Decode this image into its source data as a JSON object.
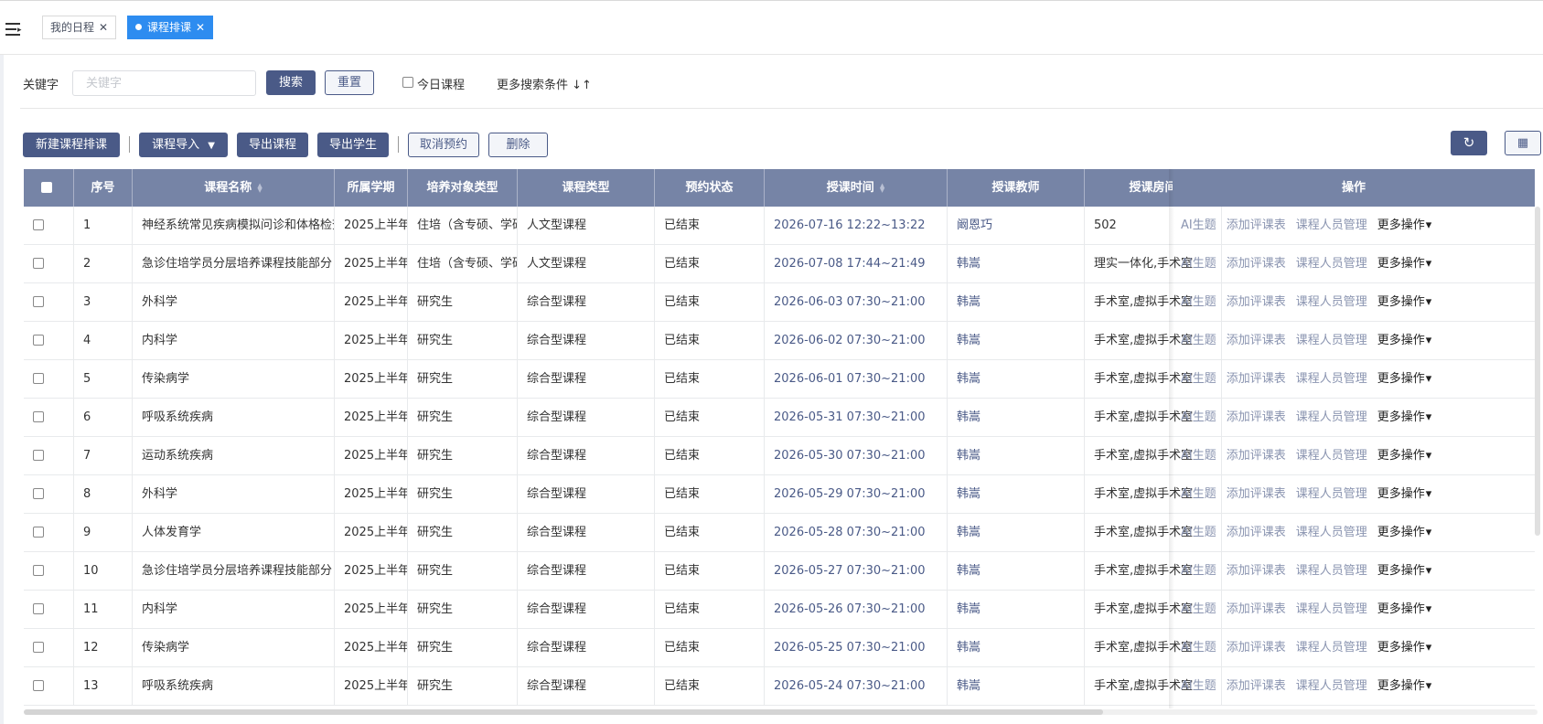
{
  "tabs": [
    {
      "label": "我的日程",
      "active": false
    },
    {
      "label": "课程排课",
      "active": true
    }
  ],
  "search": {
    "keyword_label": "关键字",
    "keyword_placeholder": "关键字",
    "keyword_value": "",
    "search_btn": "搜索",
    "reset_btn": "重置",
    "today_label": "今日课程",
    "today_checked": false,
    "more_conditions": "更多搜索条件 ↓↑"
  },
  "toolbar": {
    "new_btn": "新建课程排课",
    "import_btn": "课程导入",
    "export_course_btn": "导出课程",
    "export_student_btn": "导出学生",
    "cancel_booking_btn": "取消预约",
    "delete_btn": "删除",
    "refresh_icon": "refresh-icon",
    "grid_icon": "grid-icon"
  },
  "table": {
    "columns": [
      "",
      "序号",
      "课程名称",
      "所属学期",
      "培养对象类型",
      "课程类型",
      "预约状态",
      "授课时间",
      "授课教师",
      "授课房间",
      "操作"
    ],
    "row_ops": [
      "AI生题",
      "添加评课表",
      "课程人员管理",
      "更多操作"
    ],
    "rows": [
      [
        "1",
        "神经系统常见疾病模拟问诊和体格检查",
        "2025上半年",
        "住培（含专硕、学硕）",
        "人文型课程",
        "已结束",
        "2026-07-16 12:22~13:22",
        "阚恩巧",
        "502"
      ],
      [
        "2",
        "急诊住培学员分层培养课程技能部分",
        "2025上半年",
        "住培（含专硕、学硕）",
        "人文型课程",
        "已结束",
        "2026-07-08 17:44~21:49",
        "韩嵩",
        "理实一体化,手术室"
      ],
      [
        "3",
        "外科学",
        "2025上半年",
        "研究生",
        "综合型课程",
        "已结束",
        "2026-06-03 07:30~21:00",
        "韩嵩",
        "手术室,虚拟手术室"
      ],
      [
        "4",
        "内科学",
        "2025上半年",
        "研究生",
        "综合型课程",
        "已结束",
        "2026-06-02 07:30~21:00",
        "韩嵩",
        "手术室,虚拟手术室"
      ],
      [
        "5",
        "传染病学",
        "2025上半年",
        "研究生",
        "综合型课程",
        "已结束",
        "2026-06-01 07:30~21:00",
        "韩嵩",
        "手术室,虚拟手术室"
      ],
      [
        "6",
        "呼吸系统疾病",
        "2025上半年",
        "研究生",
        "综合型课程",
        "已结束",
        "2026-05-31 07:30~21:00",
        "韩嵩",
        "手术室,虚拟手术室"
      ],
      [
        "7",
        "运动系统疾病",
        "2025上半年",
        "研究生",
        "综合型课程",
        "已结束",
        "2026-05-30 07:30~21:00",
        "韩嵩",
        "手术室,虚拟手术室"
      ],
      [
        "8",
        "外科学",
        "2025上半年",
        "研究生",
        "综合型课程",
        "已结束",
        "2026-05-29 07:30~21:00",
        "韩嵩",
        "手术室,虚拟手术室"
      ],
      [
        "9",
        "人体发育学",
        "2025上半年",
        "研究生",
        "综合型课程",
        "已结束",
        "2026-05-28 07:30~21:00",
        "韩嵩",
        "手术室,虚拟手术室"
      ],
      [
        "10",
        "急诊住培学员分层培养课程技能部分",
        "2025上半年",
        "研究生",
        "综合型课程",
        "已结束",
        "2026-05-27 07:30~21:00",
        "韩嵩",
        "手术室,虚拟手术室"
      ],
      [
        "11",
        "内科学",
        "2025上半年",
        "研究生",
        "综合型课程",
        "已结束",
        "2026-05-26 07:30~21:00",
        "韩嵩",
        "手术室,虚拟手术室"
      ],
      [
        "12",
        "传染病学",
        "2025上半年",
        "研究生",
        "综合型课程",
        "已结束",
        "2026-05-25 07:30~21:00",
        "韩嵩",
        "手术室,虚拟手术室"
      ],
      [
        "13",
        "呼吸系统疾病",
        "2025上半年",
        "研究生",
        "综合型课程",
        "已结束",
        "2026-05-24 07:30~21:00",
        "韩嵩",
        "手术室,虚拟手术室"
      ]
    ]
  },
  "colors": {
    "header_bg": "#7684a6",
    "button_dark": "#4a5a87",
    "tab_active": "#2d8cf0",
    "link": "#4a5a87"
  }
}
